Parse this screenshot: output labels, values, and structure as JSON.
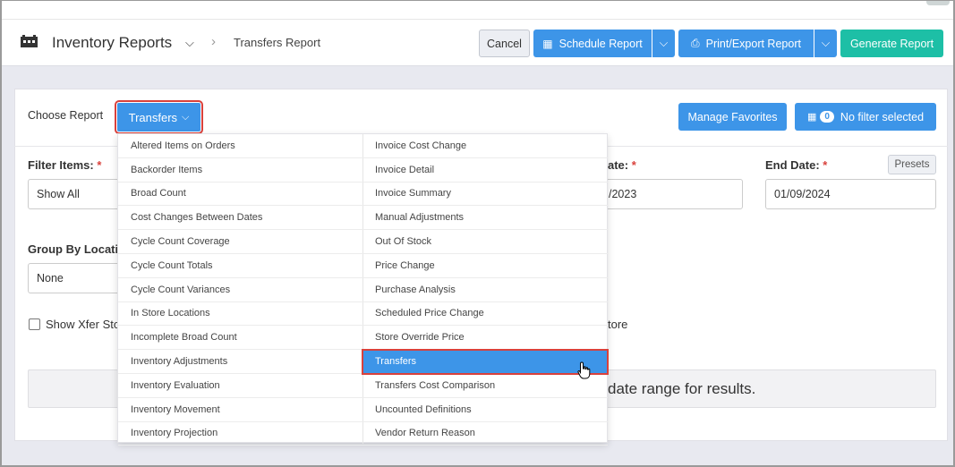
{
  "header": {
    "section_title": "Inventory Reports",
    "breadcrumb_current": "Transfers Report",
    "cancel_label": "Cancel",
    "schedule_label": "Schedule Report",
    "print_label": "Print/Export Report",
    "generate_label": "Generate Report"
  },
  "report_picker": {
    "choose_label": "Choose Report",
    "selected_report": "Transfers",
    "manage_favorites_label": "Manage Favorites",
    "filter_count": "0",
    "filter_label": "No filter selected"
  },
  "dropdown": {
    "left_items": [
      "Altered Items on Orders",
      "Backorder Items",
      "Broad Count",
      "Cost Changes Between Dates",
      "Cycle Count Coverage",
      "Cycle Count Totals",
      "Cycle Count Variances",
      "In Store Locations",
      "Incomplete Broad Count",
      "Inventory Adjustments",
      "Inventory Evaluation",
      "Inventory Movement",
      "Inventory Projection"
    ],
    "right_items": [
      "Invoice Cost Change",
      "Invoice Detail",
      "Invoice Summary",
      "Manual Adjustments",
      "Out Of Stock",
      "Price Change",
      "Purchase Analysis",
      "Scheduled Price Change",
      "Store Override Price",
      "Transfers",
      "Transfers Cost Comparison",
      "Uncounted Definitions",
      "Vendor Return Reason"
    ],
    "active_item": "Transfers"
  },
  "form": {
    "filter_items_label": "Filter Items:",
    "filter_items_value": "Show All",
    "start_date_label_visible": "ate:",
    "start_date_value_visible": "/2023",
    "end_date_label": "End Date:",
    "end_date_value": "01/09/2024",
    "presets_label": "Presets",
    "group_by_label_visible": "Group By Locati",
    "group_by_value": "None",
    "show_xfer_label_visible": "Show Xfer Sto",
    "right_checkbox_label_visible": "tore",
    "results_hint_visible": "date range for results."
  },
  "colors": {
    "primary": "#3d95e8",
    "generate": "#1dbfa6",
    "highlight": "#d9413c"
  },
  "icons": {
    "section": "calendar-grid-icon",
    "schedule": "calendar-icon",
    "print": "printer-icon",
    "filter": "filter-list-icon"
  }
}
